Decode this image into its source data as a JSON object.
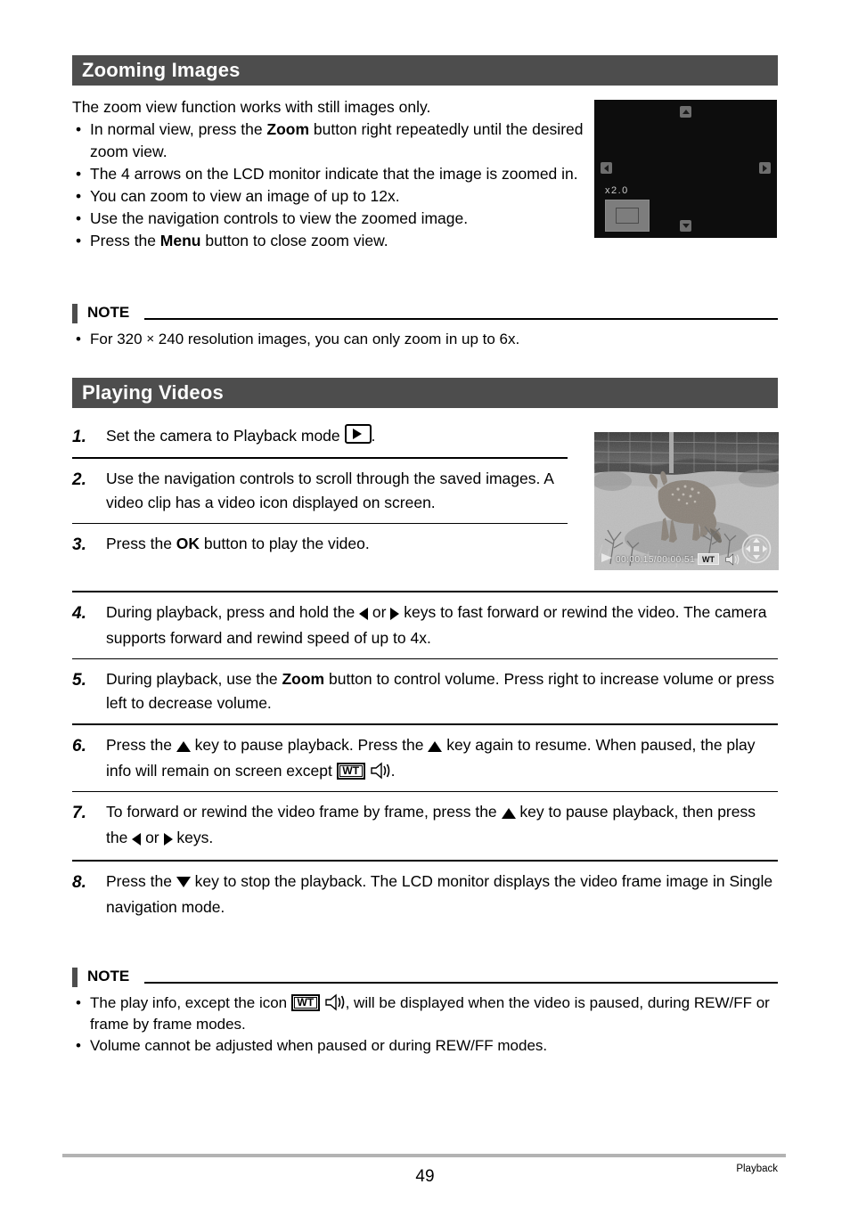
{
  "document": {
    "page_number": "49",
    "footer_label": "Playback"
  },
  "sections": [
    {
      "title": "Zooming Images",
      "lead": "The zoom view function works with still images only.",
      "bullets": [
        {
          "pre": "In normal view, press the ",
          "bold": "Zoom",
          "post": " button right repeatedly until the desired zoom view."
        },
        {
          "pre": "The 4 arrows on the LCD monitor indicate that the image is zoomed in.",
          "bold": "",
          "post": ""
        },
        {
          "pre": "You can zoom to view an image of up to 12x.",
          "bold": "",
          "post": ""
        },
        {
          "pre": "Use the navigation controls to view the zoomed image.",
          "bold": "",
          "post": ""
        },
        {
          "pre": "Press the ",
          "bold": "Menu",
          "post": " button to close zoom view."
        }
      ]
    },
    {
      "title": "Playing Videos"
    }
  ],
  "note_top": {
    "label": "NOTE",
    "bullets": [
      {
        "a": "For 320 ",
        "sym": "×",
        "b": " 240 resolution images, you can only zoom in up to 6x."
      }
    ]
  },
  "note_bottom": {
    "label": "NOTE",
    "bullet1": {
      "a": "The play info, except the icon ",
      "wt": "WT",
      "b": ", will be displayed when the video is paused, during REW/FF or frame by frame modes."
    },
    "bullet2": "Volume cannot be adjusted when paused or during REW/FF modes."
  },
  "steps": [
    {
      "num": "1.",
      "t1": "Set the camera to Playback mode ",
      "t2": "."
    },
    {
      "num": "2.",
      "t1": "Use the navigation controls to scroll through the saved images. A video clip has a video icon displayed on screen."
    },
    {
      "num": "3.",
      "t1": "Press the ",
      "bold": "OK",
      "t2": " button to play the video."
    },
    {
      "num": "4.",
      "t1": "During playback, press and hold the ",
      "t2": " or ",
      "t3": " keys to fast forward or rewind the video. The camera supports forward and rewind speed of up to 4x."
    },
    {
      "num": "5.",
      "t1": "During playback, use the ",
      "bold": "Zoom",
      "t2": " button to control volume. Press right to increase volume or press left to decrease volume."
    },
    {
      "num": "6.",
      "t1": "Press the ",
      "t2": " key to pause playback. Press the ",
      "t3": " key again to resume. When paused, the play info will remain on screen except ",
      "wt": "WT",
      "t4": "."
    },
    {
      "num": "7.",
      "t1": "To forward or rewind the video frame by frame, press the ",
      "t2": " key to pause playback, then press the ",
      "t3": " or ",
      "t4": " keys."
    },
    {
      "num": "8.",
      "t1": "Press the ",
      "t2": " key to stop the playback. The LCD monitor displays the video frame image in Single navigation mode."
    }
  ],
  "lcd_zoom_screen": {
    "zoom_ratio": "x2.0",
    "arrows": [
      "up",
      "down",
      "left",
      "right"
    ]
  },
  "video_screen": {
    "time_code": "00:00:15/00:00:51",
    "wt_badge": "WT"
  },
  "colors": {
    "header_bar": "#4d4d4d",
    "header_text": "#ffffff",
    "rule": "#000000",
    "footer_rule": "#b3b3b3",
    "lcd_background": "#0d0d0d"
  }
}
